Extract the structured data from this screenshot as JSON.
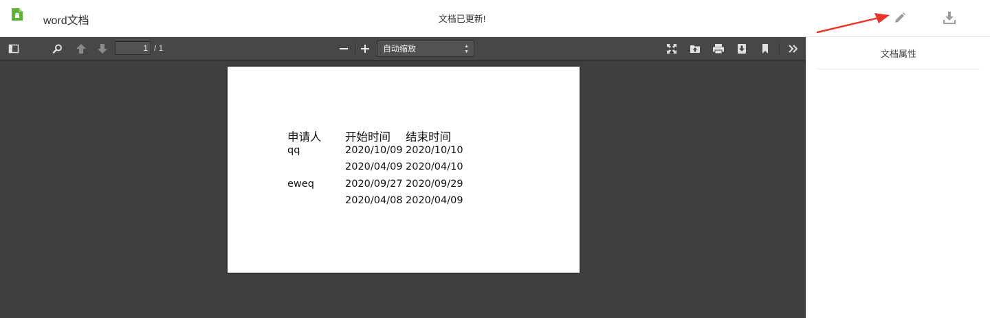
{
  "header": {
    "doc_icon": "android-file-icon",
    "doc_name": "word文档",
    "status": "文档已更新!",
    "edit_icon": "pencil-icon",
    "download_icon": "download-icon",
    "accent_color": "#5fb336",
    "annotation_arrow_color": "#e8382d"
  },
  "viewer": {
    "toolbar": {
      "sidebar_toggle_icon": "sidebar-toggle-icon",
      "search_icon": "search-icon",
      "prev_icon": "arrow-up-icon",
      "next_icon": "arrow-down-icon",
      "page_number": "1",
      "page_total": "/ 1",
      "zoom_out_icon": "minus-icon",
      "zoom_in_icon": "plus-icon",
      "zoom_value": "自动缩放",
      "presentation_icon": "fullscreen-icon",
      "open_icon": "open-file-icon",
      "print_icon": "print-icon",
      "download_icon": "download-icon",
      "bookmark_icon": "bookmark-icon",
      "tools_icon": "double-chevron-right-icon"
    },
    "document": {
      "headers": [
        "申请人",
        "开始时间",
        "结束时间"
      ],
      "rows": [
        [
          "qq",
          "2020/10/09",
          "2020/10/10"
        ],
        [
          "",
          "2020/04/09",
          "2020/04/10"
        ],
        [
          "eweq",
          "2020/09/27",
          "2020/09/29"
        ],
        [
          "",
          "2020/04/08",
          "2020/04/09"
        ]
      ]
    }
  },
  "side_panel": {
    "title": "文档属性"
  }
}
